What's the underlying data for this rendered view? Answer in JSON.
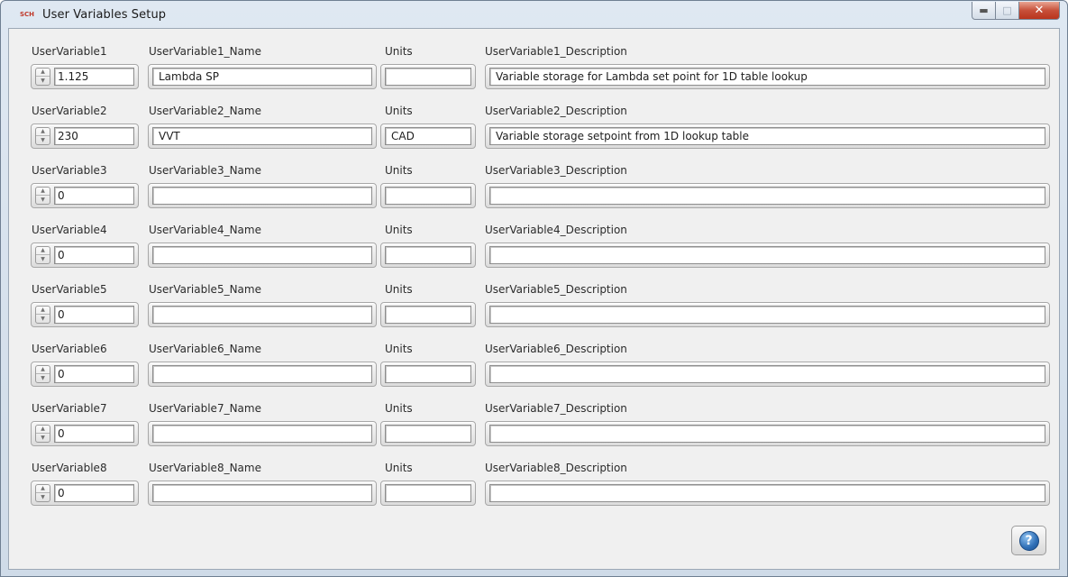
{
  "window": {
    "title": "User Variables Setup",
    "icon": "labview-vi-icon",
    "icon_text": "SCH",
    "controls": {
      "minimize": "minimize-icon",
      "maximize": "maximize-icon",
      "close": "close-icon"
    }
  },
  "rows": [
    {
      "value_label": "UserVariable1",
      "value": "1.125",
      "name_label": "UserVariable1_Name",
      "name": "Lambda SP",
      "units_label": "Units",
      "units": "",
      "desc_label": "UserVariable1_Description",
      "desc": "Variable storage for Lambda set point for 1D table lookup"
    },
    {
      "value_label": "UserVariable2",
      "value": "230",
      "name_label": "UserVariable2_Name",
      "name": "VVT",
      "units_label": "Units",
      "units": "CAD",
      "desc_label": "UserVariable2_Description",
      "desc": "Variable storage setpoint from 1D lookup table"
    },
    {
      "value_label": "UserVariable3",
      "value": "0",
      "name_label": "UserVariable3_Name",
      "name": "",
      "units_label": "Units",
      "units": "",
      "desc_label": "UserVariable3_Description",
      "desc": ""
    },
    {
      "value_label": "UserVariable4",
      "value": "0",
      "name_label": "UserVariable4_Name",
      "name": "",
      "units_label": "Units",
      "units": "",
      "desc_label": "UserVariable4_Description",
      "desc": ""
    },
    {
      "value_label": "UserVariable5",
      "value": "0",
      "name_label": "UserVariable5_Name",
      "name": "",
      "units_label": "Units",
      "units": "",
      "desc_label": "UserVariable5_Description",
      "desc": ""
    },
    {
      "value_label": "UserVariable6",
      "value": "0",
      "name_label": "UserVariable6_Name",
      "name": "",
      "units_label": "Units",
      "units": "",
      "desc_label": "UserVariable6_Description",
      "desc": ""
    },
    {
      "value_label": "UserVariable7",
      "value": "0",
      "name_label": "UserVariable7_Name",
      "name": "",
      "units_label": "Units",
      "units": "",
      "desc_label": "UserVariable7_Description",
      "desc": ""
    },
    {
      "value_label": "UserVariable8",
      "value": "0",
      "name_label": "UserVariable8_Name",
      "name": "",
      "units_label": "Units",
      "units": "",
      "desc_label": "UserVariable8_Description",
      "desc": ""
    }
  ],
  "help": {
    "icon": "help-icon",
    "glyph": "?"
  }
}
